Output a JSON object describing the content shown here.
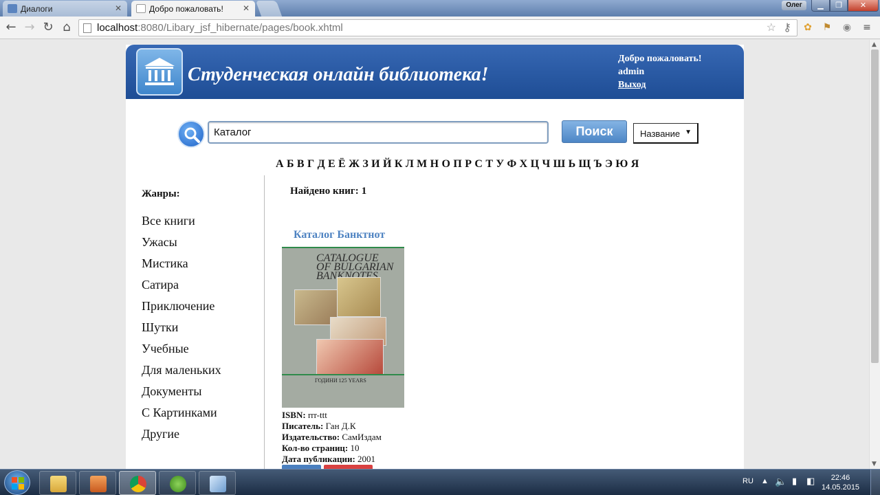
{
  "browser": {
    "tabs": [
      {
        "label": "Диалоги",
        "active": false
      },
      {
        "label": "Добро пожаловать!",
        "active": true
      }
    ],
    "profile_name": "Олег",
    "url_host": "localhost",
    "url_rest": ":8080/Libary_jsf_hibernate/pages/book.xhtml"
  },
  "header": {
    "site_title": "Студенческая онлайн библиотека!",
    "welcome": "Добро пожаловать!",
    "username": "admin",
    "logout": "Выход"
  },
  "search": {
    "query": "Каталог",
    "button_label": "Поиск",
    "mode": "Название"
  },
  "alphabet": [
    "А",
    "Б",
    "В",
    "Г",
    "Д",
    "Е",
    "Ё",
    "Ж",
    "З",
    "И",
    "Й",
    "К",
    "Л",
    "М",
    "Н",
    "О",
    "П",
    "Р",
    "С",
    "Т",
    "У",
    "Ф",
    "Х",
    "Ц",
    "Ч",
    "Ш",
    "Ь",
    "Щ",
    "Ъ",
    "Э",
    "Ю",
    "Я"
  ],
  "sidebar": {
    "title": "Жанры:",
    "genres": [
      "Все книги",
      "Ужасы",
      "Мистика",
      "Сатира",
      "Приключение",
      "Шутки",
      "Учебные",
      "Для маленьких",
      "Документы",
      "С Картинками",
      "Другие"
    ]
  },
  "results": {
    "found_label": "Найдено книг:",
    "found_count": "1"
  },
  "book": {
    "title": "Каталог Банктнот",
    "cover_text": [
      "CATALOGUE",
      "OF BULGARIAN",
      "BANKNOTES"
    ],
    "cover_footer": "ГОДИНИ 125 YEARS",
    "isbn_label": "ISBN:",
    "isbn": "rrr-ttt",
    "author_label": "Писатель:",
    "author": "Ган Д.К",
    "publisher_label": "Издательство:",
    "publisher": "СамИздам",
    "pages_label": "Кол-во страниц:",
    "pages": "10",
    "date_label": "Дата публикации:",
    "date": "2001"
  },
  "taskbar": {
    "language": "RU",
    "time": "22:46",
    "date": "14.05.2015"
  }
}
